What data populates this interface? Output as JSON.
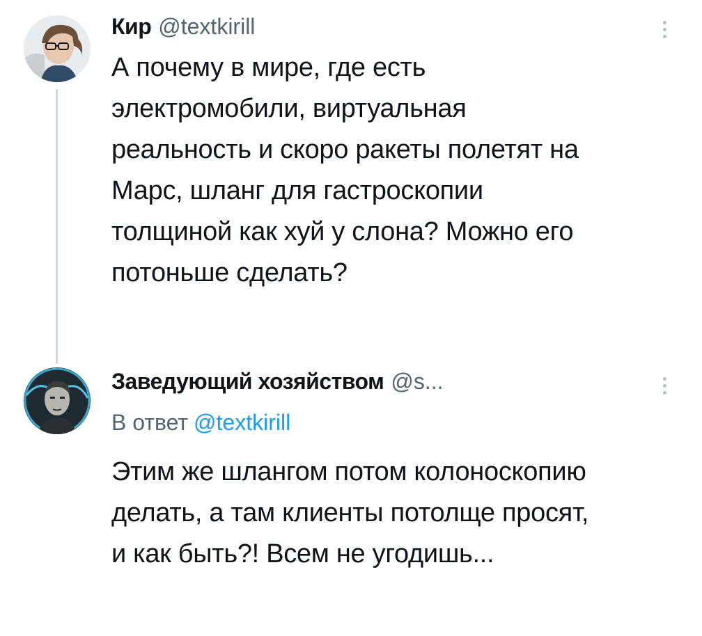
{
  "colors": {
    "text": "#0f1419",
    "secondary": "#536471",
    "link": "#1d9bf0",
    "thread_line": "#cfd9de"
  },
  "tweets": [
    {
      "display_name": "Кир",
      "handle": "@textkirill",
      "avatar_icon": "user-avatar-glasses",
      "more_icon": "more-vertical-icon",
      "text_lines": [
        "А почему в мире, где есть",
        "электромобили, виртуальная",
        "реальность и скоро ракеты полетят на",
        "Марс, шланг для гастроскопии",
        "толщиной как хуй у слона? Можно его",
        "потоньше сделать?"
      ]
    },
    {
      "display_name": "Заведующий хозяйством",
      "handle": "@s...",
      "avatar_icon": "user-avatar-drawn-portrait",
      "more_icon": "more-vertical-icon",
      "reply_prefix": "В ответ",
      "reply_mention": "@textkirill",
      "text_lines": [
        "Этим же шлангом потом колоноскопию",
        "делать, а там клиенты потолще просят,",
        "и как быть?! Всем не угодишь..."
      ]
    }
  ]
}
